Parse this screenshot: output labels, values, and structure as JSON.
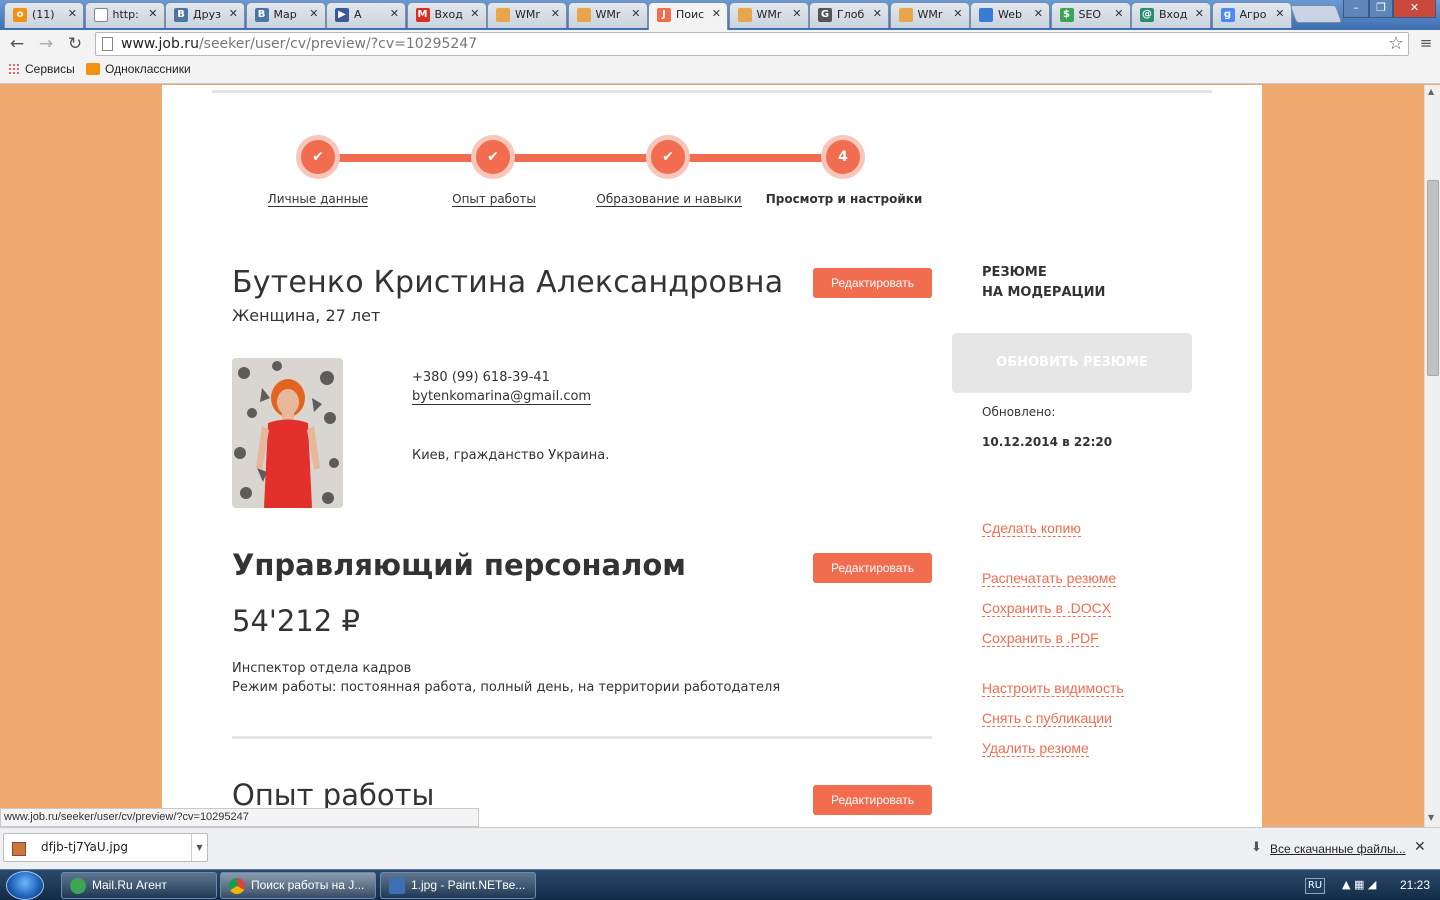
{
  "browser": {
    "tabs": [
      {
        "title": "(11)",
        "icon": "odnoklassniki-icon",
        "color": "#f29111",
        "glyph": "о"
      },
      {
        "title": "http:",
        "icon": "page-icon",
        "color": "#ffffff",
        "glyph": ""
      },
      {
        "title": "Друз",
        "icon": "vk-icon",
        "color": "#4c75a3",
        "glyph": "В"
      },
      {
        "title": "Мар",
        "icon": "vk-icon",
        "color": "#4c75a3",
        "glyph": "В"
      },
      {
        "title": "А",
        "icon": "play-icon",
        "color": "#3b5998",
        "glyph": "▶"
      },
      {
        "title": "Вход",
        "icon": "gmail-icon",
        "color": "#d93025",
        "glyph": "M"
      },
      {
        "title": "WMr",
        "icon": "webmoney-icon",
        "color": "#e7a64a",
        "glyph": ""
      },
      {
        "title": "WMr",
        "icon": "webmoney-icon",
        "color": "#e7a64a",
        "glyph": ""
      },
      {
        "title": "Поис",
        "icon": "jobru-icon",
        "color": "#f26c4f",
        "glyph": "J"
      },
      {
        "title": "WMr",
        "icon": "webmoney-icon",
        "color": "#e7a64a",
        "glyph": ""
      },
      {
        "title": "Глоб",
        "icon": "g-icon",
        "color": "#555555",
        "glyph": "G"
      },
      {
        "title": "WMr",
        "icon": "webmoney-icon",
        "color": "#e7a64a",
        "glyph": ""
      },
      {
        "title": "Web",
        "icon": "globe-icon",
        "color": "#3a7bd5",
        "glyph": ""
      },
      {
        "title": "SEO",
        "icon": "dollar-icon",
        "color": "#3aa655",
        "glyph": "$"
      },
      {
        "title": "Вход",
        "icon": "chrome-mail-icon",
        "color": "#2c8f6b",
        "glyph": "@"
      },
      {
        "title": "Агро",
        "icon": "google-icon",
        "color": "#4a8af4",
        "glyph": "g"
      }
    ],
    "url_host": "www.job.ru",
    "url_path": "/seeker/user/cv/preview/?cv=10295247",
    "bookmarks": {
      "apps": "Сервисы",
      "ok": "Одноклассники"
    },
    "status_url": "www.job.ru/seeker/user/cv/preview/?cv=10295247",
    "download_file": "dfjb-tj7YaU.jpg",
    "all_downloads": "Все скачанные файлы..."
  },
  "steps": [
    {
      "label": "Личные данные",
      "done": true,
      "marker": "✔"
    },
    {
      "label": "Опыт работы",
      "done": true,
      "marker": "✔"
    },
    {
      "label": "Образование и навыки",
      "done": true,
      "marker": "✔"
    },
    {
      "label": "Просмотр и настройки",
      "done": false,
      "marker": "4"
    }
  ],
  "resume": {
    "name": "Бутенко Кристина Александровна",
    "gender_age": "Женщина, 27 лет",
    "phone": "+380 (99) 618-39-41",
    "email": "bytenkomarina@gmail.com",
    "location": "Киев, гражданство Украина.",
    "position": "Управляющий персоналом",
    "salary": "54'212 ₽",
    "specialization": "Инспектор отдела кадров",
    "work_mode": "Режим работы: постоянная работа, полный день, на территории работодателя",
    "experience_title": "Опыт работы",
    "edit_label": "Редактировать"
  },
  "sidebar": {
    "status": "РЕЗЮМЕ\nНА МОДЕРАЦИИ",
    "refresh_button": "ОБНОВИТЬ РЕЗЮМЕ",
    "updated_label": "Обновлено:",
    "updated_date": "10.12.2014 в 22:20",
    "actions": {
      "copy": "Сделать копию",
      "print": "Распечатать резюме",
      "docx": "Сохранить в .DOCX",
      "pdf": "Сохранить в .PDF",
      "visibility": "Настроить видимость",
      "unpublish": "Снять с публикации",
      "delete": "Удалить резюме"
    }
  },
  "taskbar": {
    "items": [
      "Mail.Ru Агент",
      "Поиск работы на J...",
      "1.jpg - Paint.NETве..."
    ],
    "lang": "RU",
    "time": "21:23"
  },
  "colors": {
    "accent": "#f26c4f",
    "page_bg": "#f1ab70"
  }
}
